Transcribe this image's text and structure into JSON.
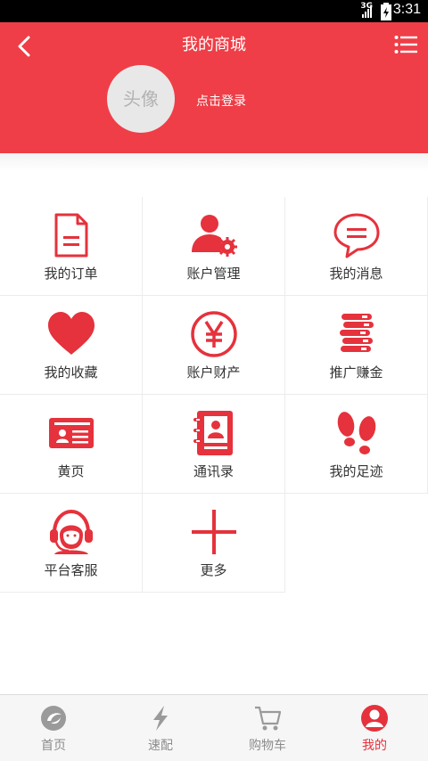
{
  "status_bar": {
    "network": "3G",
    "time": "3:31"
  },
  "header": {
    "title": "我的商城",
    "avatar_text": "头像",
    "login_text": "点击登录"
  },
  "grid": [
    {
      "label": "我的订单",
      "icon": "document-icon"
    },
    {
      "label": "账户管理",
      "icon": "user-settings-icon"
    },
    {
      "label": "我的消息",
      "icon": "message-bubble-icon"
    },
    {
      "label": "我的收藏",
      "icon": "heart-icon"
    },
    {
      "label": "账户财产",
      "icon": "yen-coin-icon"
    },
    {
      "label": "推广赚金",
      "icon": "coin-stack-icon"
    },
    {
      "label": "黄页",
      "icon": "id-card-icon"
    },
    {
      "label": "通讯录",
      "icon": "address-book-icon"
    },
    {
      "label": "我的足迹",
      "icon": "footprints-icon"
    },
    {
      "label": "平台客服",
      "icon": "headset-agent-icon"
    },
    {
      "label": "更多",
      "icon": "plus-icon"
    }
  ],
  "bottom_nav": [
    {
      "label": "首页",
      "icon": "home-icon",
      "active": false
    },
    {
      "label": "速配",
      "icon": "lightning-icon",
      "active": false
    },
    {
      "label": "购物车",
      "icon": "cart-icon",
      "active": false
    },
    {
      "label": "我的",
      "icon": "profile-icon",
      "active": true
    }
  ],
  "colors": {
    "brand_red": "#ef3e47",
    "icon_red": "#e5323c",
    "inactive_gray": "#8c8c8c"
  }
}
